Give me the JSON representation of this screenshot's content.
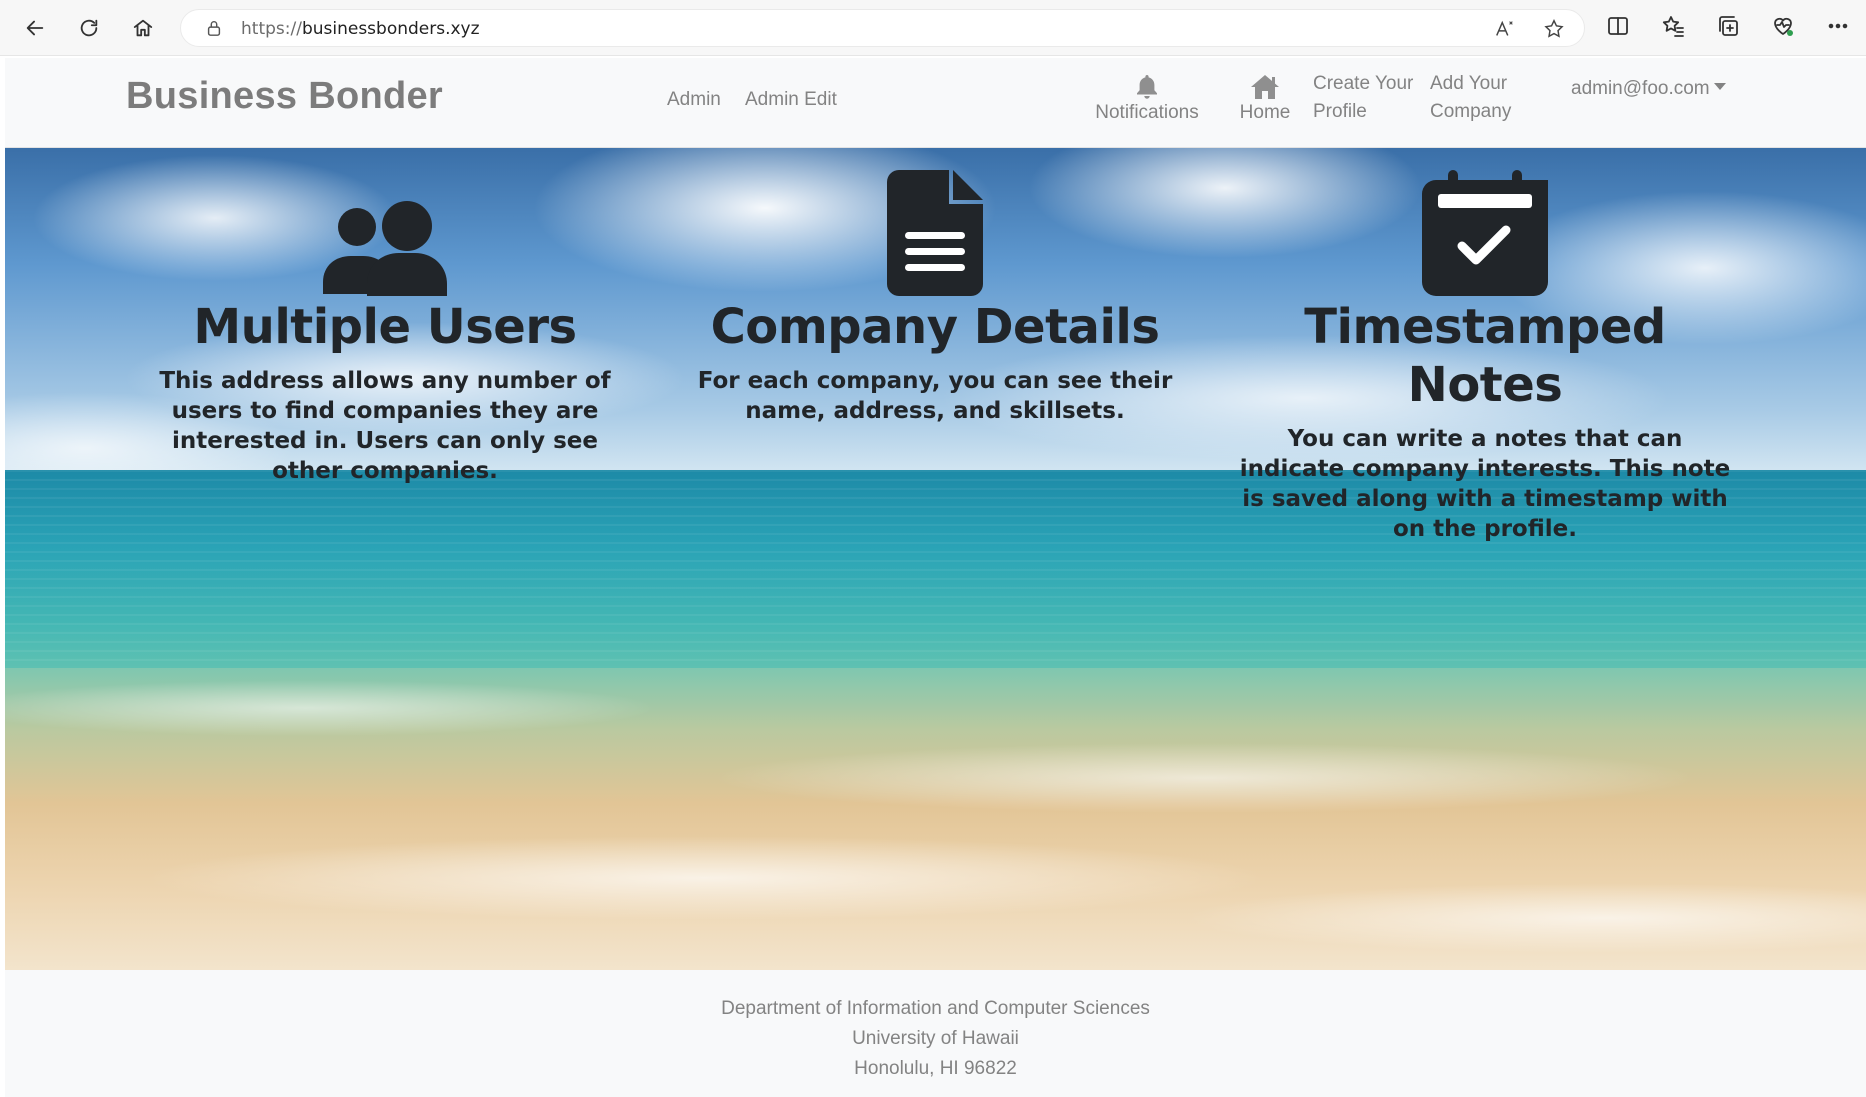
{
  "browser": {
    "url_scheme": "https://",
    "url_host": "businessbonders.xyz"
  },
  "navbar": {
    "brand": "Business Bonder",
    "links": {
      "admin": "Admin",
      "admin_edit": "Admin Edit",
      "notifications": "Notifications",
      "home": "Home",
      "create_profile_line1": "Create Your",
      "create_profile_line2": "Profile",
      "add_company_line1": "Add Your",
      "add_company_line2": "Company",
      "user_menu": "admin@foo.com"
    }
  },
  "features": [
    {
      "icon": "users-icon",
      "title": "Multiple Users",
      "description": "This address allows any number of users to find companies they are interested in. Users can only see other companies."
    },
    {
      "icon": "file-lines-icon",
      "title": "Company Details",
      "description": "For each company, you can see their name, address, and skillsets."
    },
    {
      "icon": "calendar-check-icon",
      "title": "Timestamped Notes",
      "description": "You can write a notes that can indicate company interests. This note is saved along with a timestamp with on the profile."
    }
  ],
  "footer": {
    "line1": "Department of Information and Computer Sciences",
    "line2": "University of Hawaii",
    "line3": "Honolulu, HI 96822"
  },
  "colors": {
    "navbar_bg": "#f8f9fa",
    "nav_text": "#838383",
    "hero_text": "#212529"
  }
}
